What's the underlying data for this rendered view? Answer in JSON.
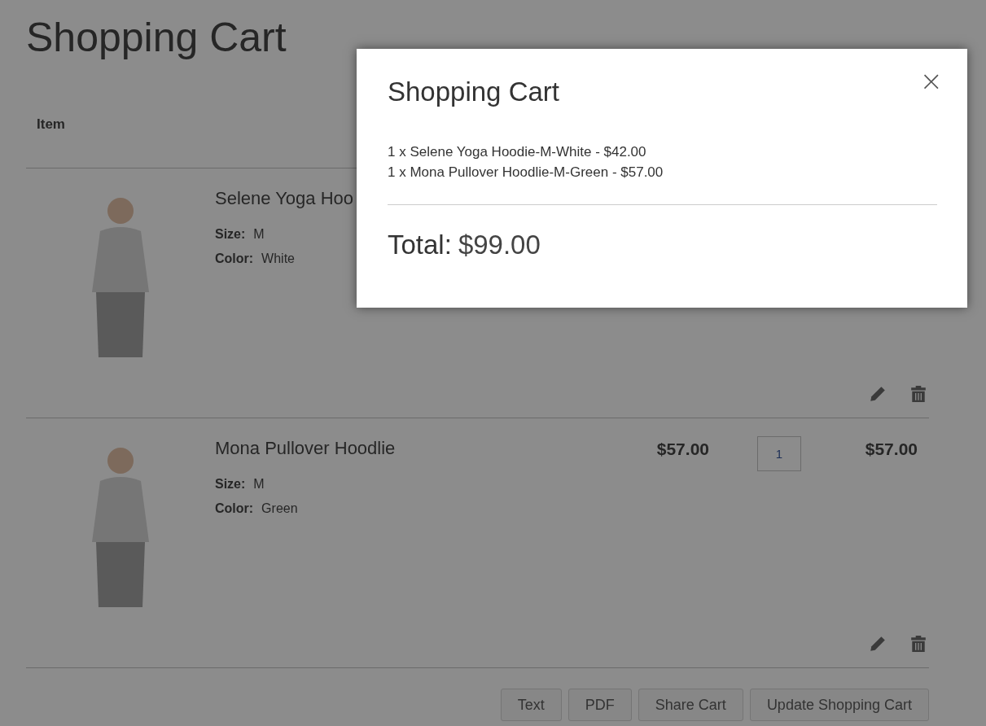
{
  "page": {
    "title": "Shopping Cart"
  },
  "table": {
    "columns": [
      "Item"
    ],
    "rows": [
      {
        "name": "Selene Yoga Hoo",
        "options": [
          {
            "label": "Size:",
            "value": "M"
          },
          {
            "label": "Color:",
            "value": "White"
          }
        ]
      },
      {
        "name": "Mona Pullover Hoodlie",
        "price": "$57.00",
        "qty": "1",
        "subtotal": "$57.00",
        "options": [
          {
            "label": "Size:",
            "value": "M"
          },
          {
            "label": "Color:",
            "value": "Green"
          }
        ]
      }
    ]
  },
  "buttons": [
    "Text",
    "PDF",
    "Share Cart",
    "Update Shopping Cart"
  ],
  "modal": {
    "title": "Shopping Cart",
    "close": "×",
    "lines": [
      "1 x Selene Yoga Hoodie-M-White - $42.00",
      "1 x Mona Pullover Hoodlie-M-Green - $57.00"
    ],
    "total_label": "Total:",
    "total_value": "$99.00"
  }
}
